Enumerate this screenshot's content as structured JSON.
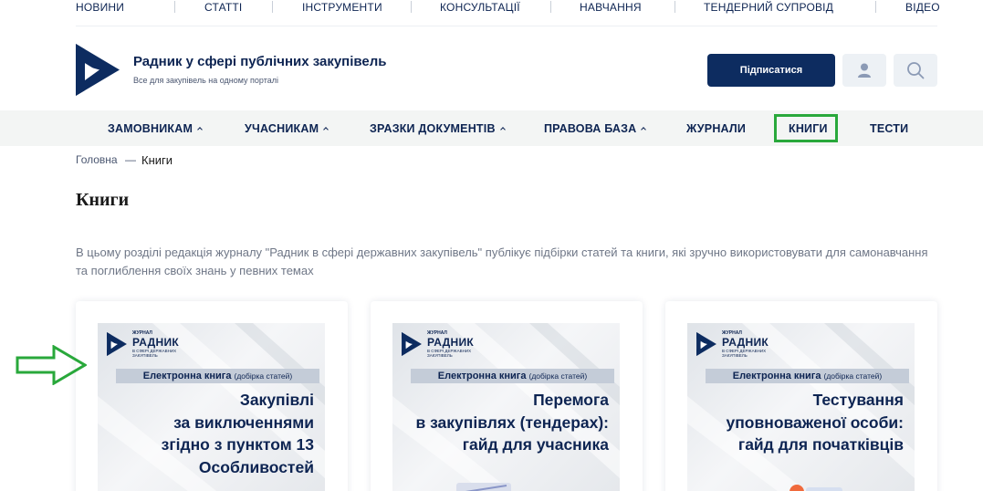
{
  "top_nav": [
    "НОВИНИ",
    "СТАТТІ",
    "ІНСТРУМЕНТИ",
    "КОНСУЛЬТАЦІЇ",
    "НАВЧАННЯ",
    "ТЕНДЕРНИЙ СУПРОВІД",
    "ВІДЕО"
  ],
  "header": {
    "title": "Радник у сфері публічних закупівель",
    "subtitle": "Все для закупівель на одному порталі",
    "subscribe_label": "Підписатися"
  },
  "main_nav": [
    {
      "label": "ЗАМОВНИКАМ",
      "dropdown": true
    },
    {
      "label": "УЧАСНИКАМ",
      "dropdown": true
    },
    {
      "label": "ЗРАЗКИ ДОКУМЕНТІВ",
      "dropdown": true
    },
    {
      "label": "ПРАВОВА БАЗА",
      "dropdown": true
    },
    {
      "label": "ЖУРНАЛИ",
      "dropdown": false
    },
    {
      "label": "КНИГИ",
      "dropdown": false,
      "active": true
    },
    {
      "label": "ТЕСТИ",
      "dropdown": false
    }
  ],
  "breadcrumb": {
    "home": "Головна",
    "separator": "—",
    "current": "Книги"
  },
  "page": {
    "title": "Книги",
    "intro": "В цьому розділі редакція журналу \"Радник в сфері державних закупівель\" публікує підбірки статей та книги, які зручно використовувати для самонавчання та поглиблення своїх знань у певних темах"
  },
  "cover_common": {
    "journal": "ЖУРНАЛ",
    "brand": "РАДНИК",
    "brand_sub": "В СФЕРІ ДЕРЖАВНИХ ЗАКУПІВЕЛЬ",
    "badge": "Електронна книга",
    "badge_small": "(добірка статей)"
  },
  "books": [
    {
      "title": "Закупівлі\nза виключеннями\nзгідно з пунктом 13\nОсобливостей"
    },
    {
      "title": "Перемога\nв закупівлях (тендерах):\nгайд для учасника"
    },
    {
      "title": "Тестування\nуповноваженої особи:\nгайд для початківців"
    }
  ],
  "colors": {
    "brand": "#0d2c60",
    "highlight": "#29a83b",
    "nav_bg": "#f3f5f4"
  }
}
